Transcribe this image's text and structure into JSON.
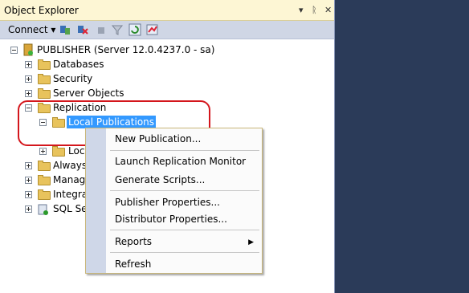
{
  "window": {
    "title": "Object Explorer",
    "pin_icon": "▾",
    "dock_icon": "ᚱ",
    "close_icon": "✕"
  },
  "toolbar": {
    "connect_label": "Connect ▾"
  },
  "tree": {
    "root": "PUBLISHER (Server 12.0.4237.0 - sa)",
    "databases": "Databases",
    "security": "Security",
    "server_objects": "Server Objects",
    "replication": "Replication",
    "local_publications": "Local Publications",
    "local_subscriptions": "Loc",
    "alwayson": "Always",
    "management": "Manag",
    "integration": "Integrat",
    "agent": "SQL Ser"
  },
  "context_menu": {
    "new_publication": "New Publication...",
    "launch_monitor": "Launch Replication Monitor",
    "generate_scripts": "Generate Scripts...",
    "publisher_properties": "Publisher Properties...",
    "distributor_properties": "Distributor Properties...",
    "reports": "Reports",
    "refresh": "Refresh"
  },
  "colors": {
    "selection": "#3399ff",
    "highlight_ring": "#d4161c",
    "background": "#2b3b59"
  }
}
